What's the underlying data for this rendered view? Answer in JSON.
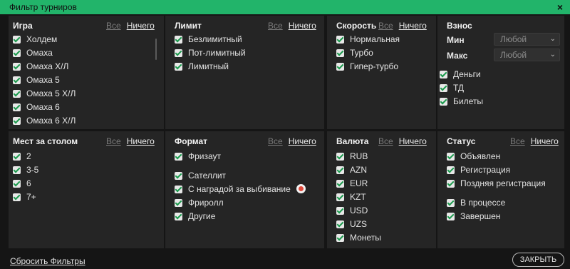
{
  "window": {
    "title": "Фильтр турниров",
    "close_glyph": "×"
  },
  "links": {
    "all": "Все",
    "none": "Ничего"
  },
  "game": {
    "title": "Игра",
    "items": [
      "Холдем",
      "Омаха",
      "Омаха Х/Л",
      "Омаха 5",
      "Омаха 5 Х/Л",
      "Омаха 6",
      "Омаха 6 Х/Л"
    ]
  },
  "limit": {
    "title": "Лимит",
    "items": [
      "Безлимитный",
      "Пот-лимитный",
      "Лимитный"
    ]
  },
  "speed": {
    "title": "Скорость",
    "items": [
      "Нормальная",
      "Турбо",
      "Гипер-турбо"
    ]
  },
  "buyin": {
    "title": "Взнос",
    "min_label": "Мин",
    "max_label": "Макс",
    "min_value": "Любой",
    "max_value": "Любой",
    "items": [
      "Деньги",
      "ТД",
      "Билеты"
    ]
  },
  "seats": {
    "title": "Мест за столом",
    "items": [
      "2",
      "3-5",
      "6",
      "7+"
    ]
  },
  "format": {
    "title": "Формат",
    "items": [
      "Фризаут",
      "Сателлит",
      "С наградой за выбивание",
      "Фриролл",
      "Другие"
    ]
  },
  "currency": {
    "title": "Валюта",
    "items": [
      "RUB",
      "AZN",
      "EUR",
      "KZT",
      "USD",
      "UZS",
      "Монеты"
    ]
  },
  "status": {
    "title": "Статус",
    "items": [
      "Объявлен",
      "Регистрация",
      "Поздняя регистрация",
      "В процессе",
      "Завершен"
    ]
  },
  "footer": {
    "reset": "Сбросить Фильтры",
    "close": "ЗАКРЫТЬ"
  },
  "colors": {
    "accent": "#22b46a",
    "check": "#1a9a4c",
    "panel": "#252525"
  }
}
